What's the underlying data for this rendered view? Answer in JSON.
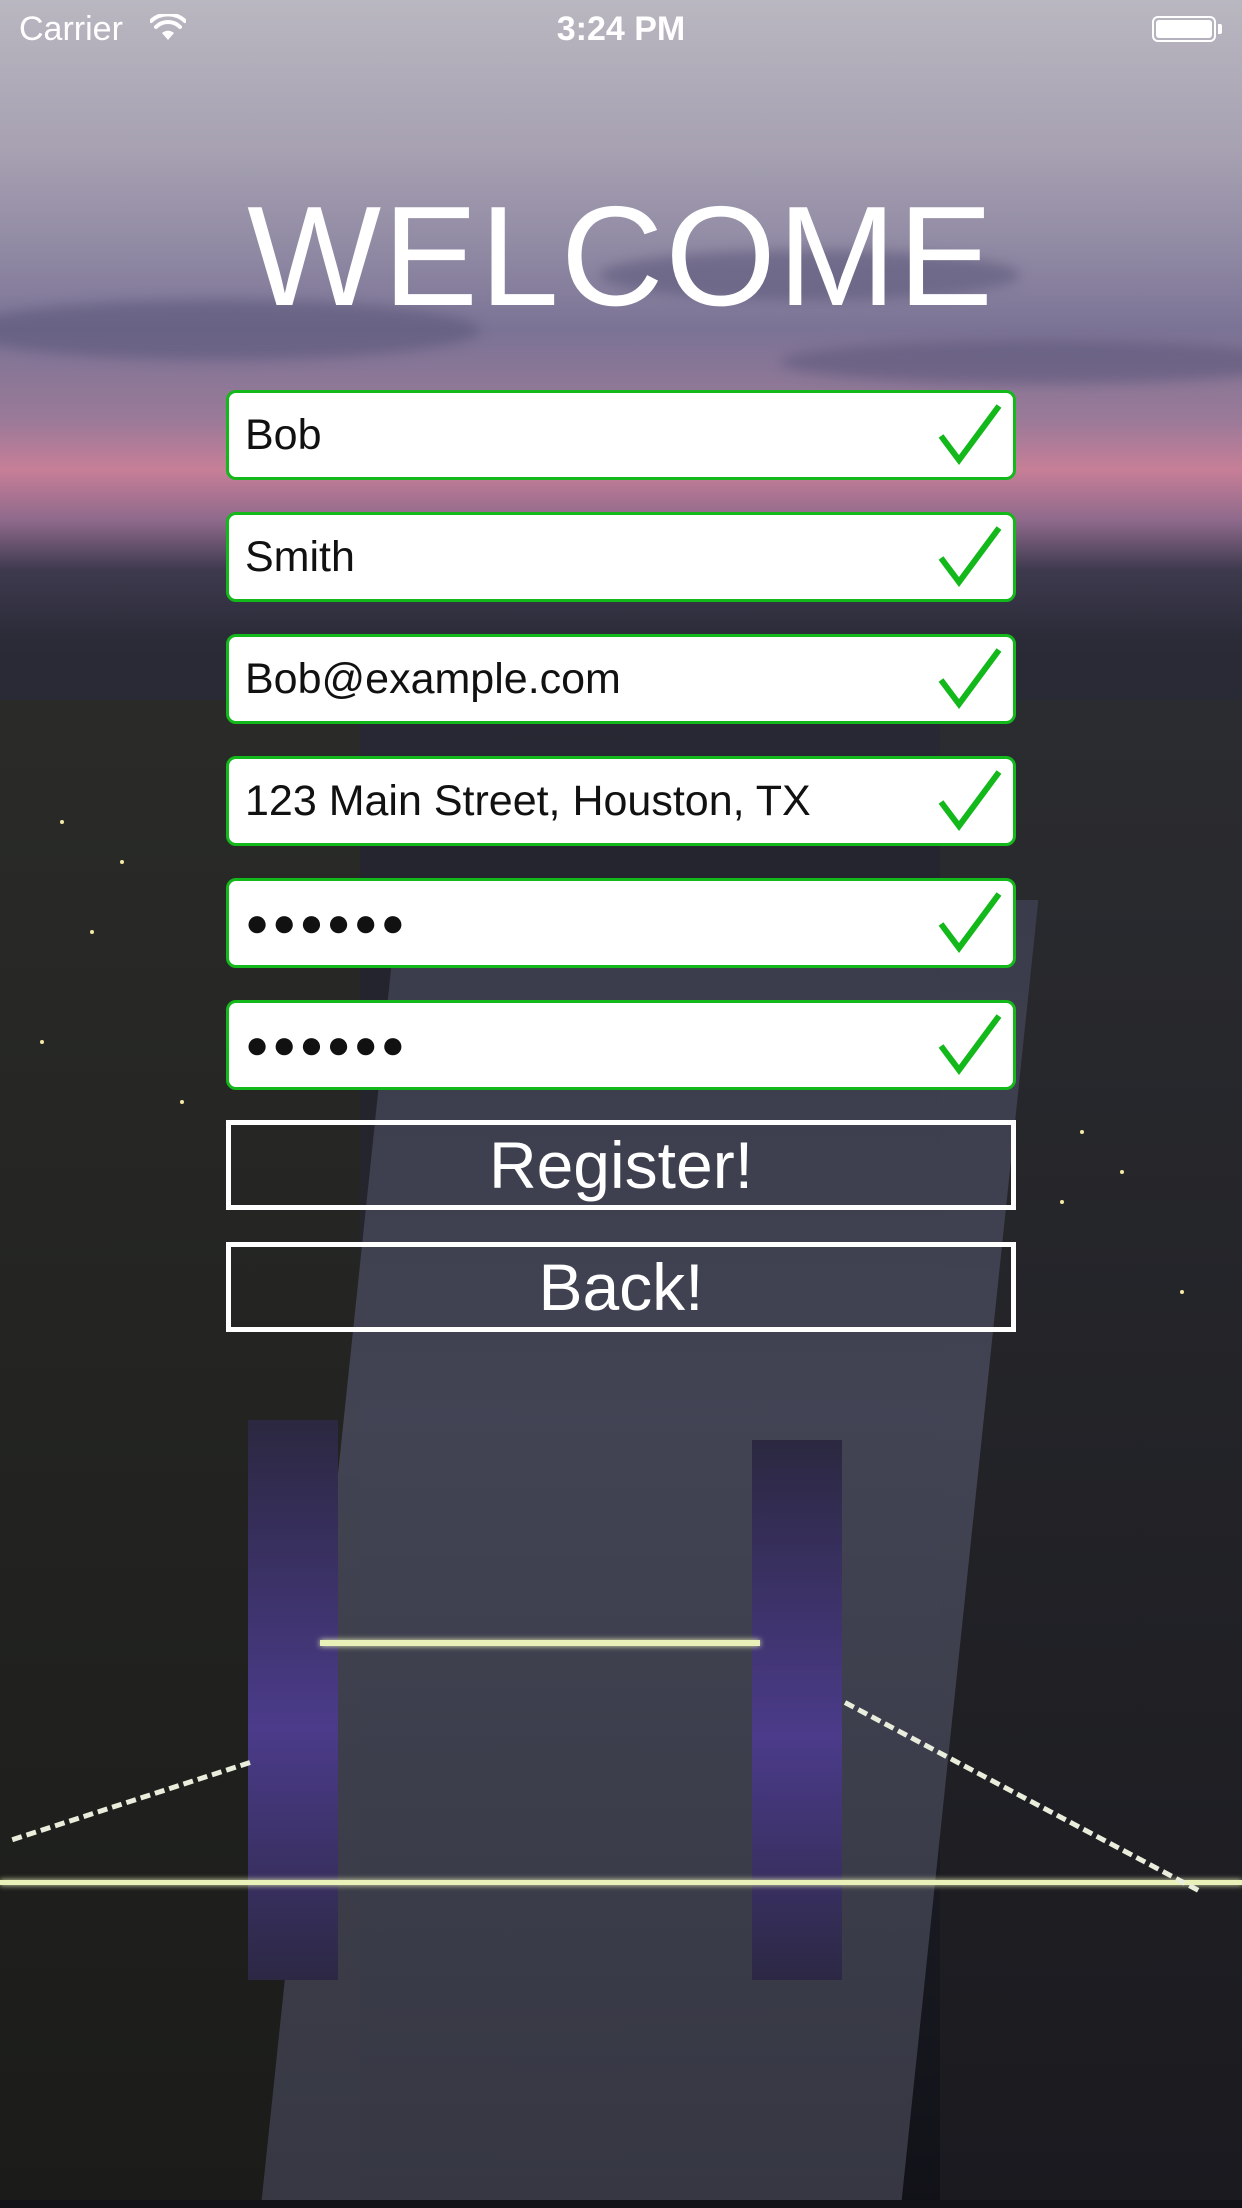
{
  "status_bar": {
    "carrier": "Carrier",
    "time": "3:24 PM",
    "wifi_icon": "wifi-icon",
    "battery_icon": "battery-icon"
  },
  "title": "WELCOME",
  "form": {
    "accent_color": "#13b81b",
    "fields": [
      {
        "value": "Bob",
        "valid": true,
        "icon": "checkmark-icon"
      },
      {
        "value": "Smith",
        "valid": true,
        "icon": "checkmark-icon"
      },
      {
        "value": "Bob@example.com",
        "valid": true,
        "icon": "checkmark-icon"
      },
      {
        "value": "123 Main Street, Houston, TX",
        "valid": true,
        "icon": "checkmark-icon"
      },
      {
        "value": "●●●●●●",
        "valid": true,
        "icon": "checkmark-icon"
      },
      {
        "value": "●●●●●●",
        "valid": true,
        "icon": "checkmark-icon"
      }
    ]
  },
  "buttons": {
    "register": "Register!",
    "back": "Back!"
  }
}
